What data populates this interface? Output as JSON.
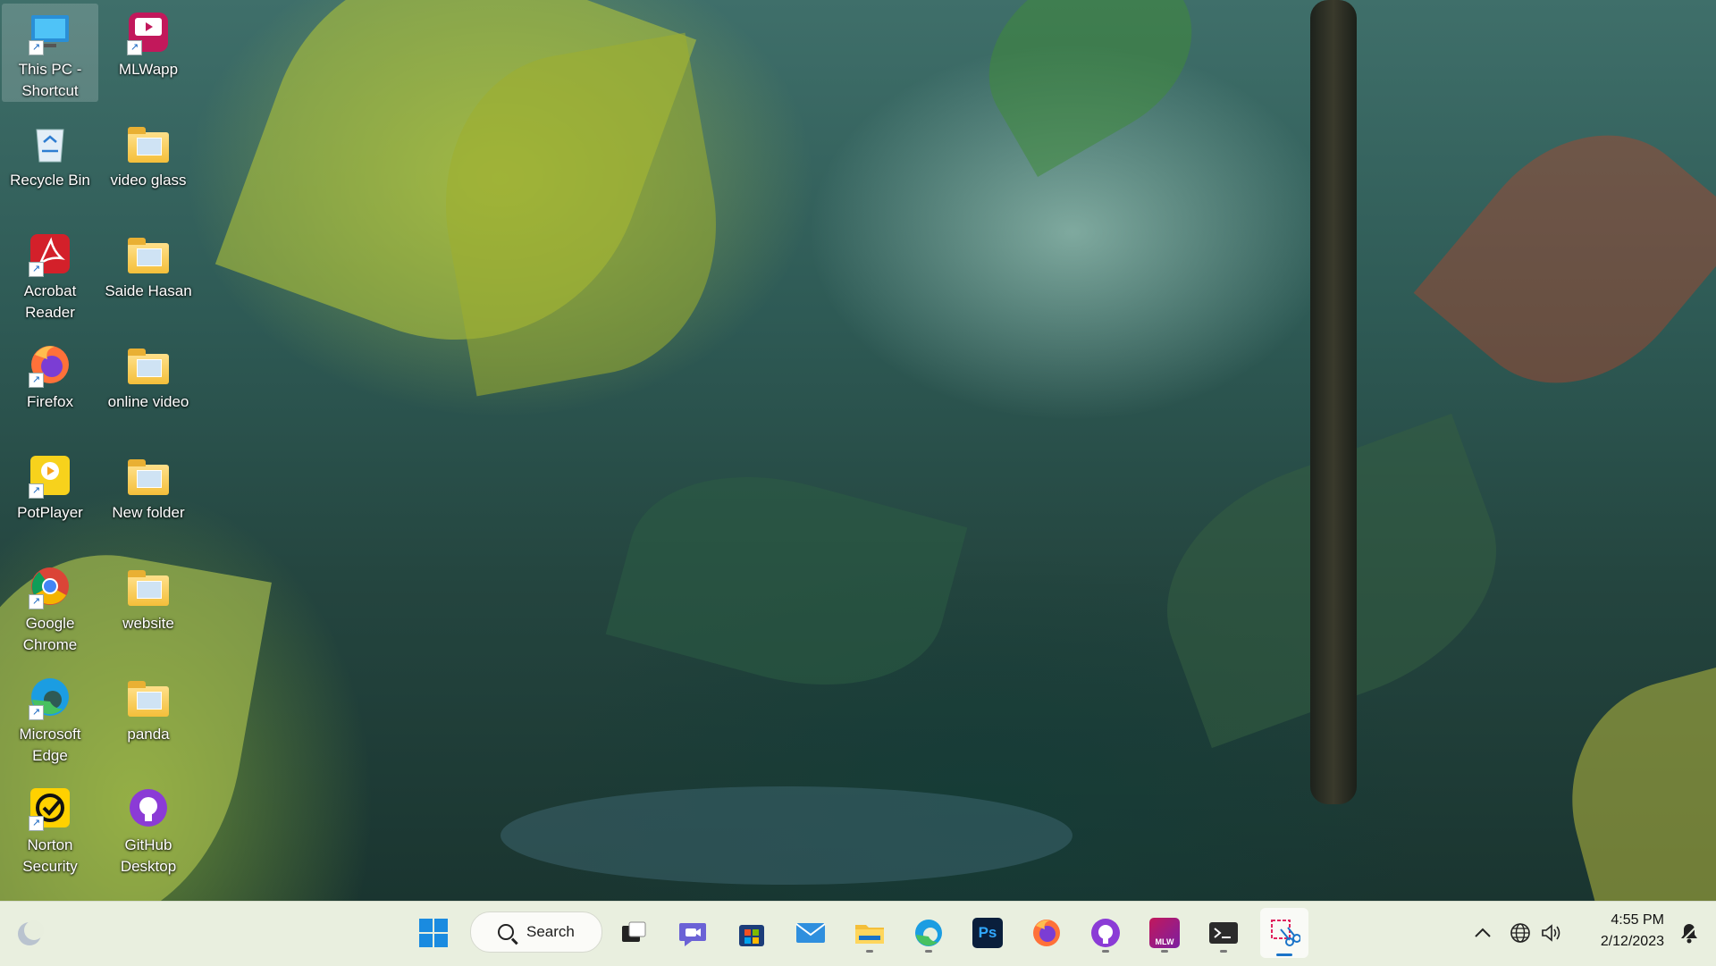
{
  "desktop": {
    "icons": [
      {
        "label": "This PC - Shortcut",
        "icon": "computer-icon",
        "shortcut": true
      },
      {
        "label": "MLWapp",
        "icon": "mlwapp-icon",
        "shortcut": true
      },
      {
        "label": "Recycle Bin",
        "icon": "recycle-bin-icon",
        "shortcut": false
      },
      {
        "label": "video glass",
        "icon": "folder-icon",
        "shortcut": false
      },
      {
        "label": "Acrobat Reader",
        "icon": "acrobat-icon",
        "shortcut": true
      },
      {
        "label": "Saide Hasan",
        "icon": "folder-icon",
        "shortcut": false
      },
      {
        "label": "Firefox",
        "icon": "firefox-icon",
        "shortcut": true
      },
      {
        "label": "online video",
        "icon": "folder-icon",
        "shortcut": false
      },
      {
        "label": "PotPlayer",
        "icon": "potplayer-icon",
        "shortcut": true
      },
      {
        "label": "New folder",
        "icon": "folder-icon",
        "shortcut": false
      },
      {
        "label": "Google Chrome",
        "icon": "chrome-icon",
        "shortcut": true
      },
      {
        "label": "website",
        "icon": "folder-icon",
        "shortcut": false
      },
      {
        "label": "Microsoft Edge",
        "icon": "edge-icon",
        "shortcut": true
      },
      {
        "label": "panda",
        "icon": "folder-icon",
        "shortcut": false
      },
      {
        "label": "Norton Security",
        "icon": "norton-icon",
        "shortcut": true
      },
      {
        "label": "GitHub Desktop",
        "icon": "github-desktop-icon",
        "shortcut": false
      }
    ]
  },
  "taskbar": {
    "search_label": "Search",
    "pinned": [
      {
        "name": "start",
        "icon": "windows-start-icon"
      },
      {
        "name": "task-view",
        "icon": "task-view-icon"
      },
      {
        "name": "chat",
        "icon": "teams-chat-icon"
      },
      {
        "name": "microsoft-store",
        "icon": "store-icon"
      },
      {
        "name": "mail",
        "icon": "mail-icon"
      },
      {
        "name": "file-explorer",
        "icon": "file-explorer-icon"
      },
      {
        "name": "edge",
        "icon": "edge-icon"
      },
      {
        "name": "photoshop",
        "icon": "photoshop-icon"
      },
      {
        "name": "firefox",
        "icon": "firefox-icon"
      },
      {
        "name": "github-desktop",
        "icon": "github-desktop-icon"
      },
      {
        "name": "mlwapp",
        "icon": "mlwapp-icon"
      },
      {
        "name": "terminal",
        "icon": "terminal-icon"
      },
      {
        "name": "snipping-tool",
        "icon": "snipping-tool-icon"
      }
    ],
    "photoshop_label": "Ps",
    "mlw_label": "MLW"
  },
  "tray": {
    "time": "4:55 PM",
    "date": "2/12/2023"
  },
  "colors": {
    "taskbar_bg": "#e8eede",
    "accent": "#1a73c8",
    "folder_yellow": "#f4bf3a"
  }
}
